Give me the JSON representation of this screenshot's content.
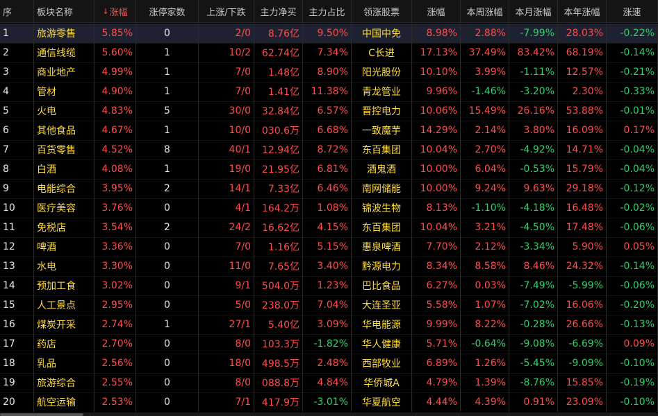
{
  "headers": [
    {
      "key": "idx",
      "label": "序"
    },
    {
      "key": "name",
      "label": "板块名称"
    },
    {
      "key": "pct",
      "label": "涨幅",
      "active": true
    },
    {
      "key": "limit",
      "label": "涨停家数"
    },
    {
      "key": "updown",
      "label": "上涨/下跌"
    },
    {
      "key": "netbuy",
      "label": "主力净买"
    },
    {
      "key": "ratio",
      "label": "主力占比"
    },
    {
      "key": "lead",
      "label": "领涨股票"
    },
    {
      "key": "lpct",
      "label": "涨幅"
    },
    {
      "key": "week",
      "label": "本周涨幅"
    },
    {
      "key": "month",
      "label": "本月涨幅"
    },
    {
      "key": "year",
      "label": "本年涨幅"
    },
    {
      "key": "speed",
      "label": "涨速"
    }
  ],
  "colors": {
    "red": "#ff4d4d",
    "green": "#2ed26a",
    "yellow": "#ffdc40",
    "white": "#e6e6e6"
  },
  "rows": [
    {
      "idx": "1",
      "name": "旅游零售",
      "pct": "5.85%",
      "limit": "0",
      "updown": "2/0",
      "netbuy": "8.76亿",
      "ratio": "9.50%",
      "lead": "中国中免",
      "lpct": "8.98%",
      "week": "2.88%",
      "month": "-7.99%",
      "year": "28.03%",
      "speed": "-0.22%"
    },
    {
      "idx": "2",
      "name": "通信线缆",
      "pct": "5.60%",
      "limit": "1",
      "updown": "10/2",
      "netbuy": "62.74亿",
      "ratio": "7.34%",
      "lead": "C长进",
      "lpct": "17.13%",
      "week": "37.49%",
      "month": "83.42%",
      "year": "68.19%",
      "speed": "-0.14%"
    },
    {
      "idx": "3",
      "name": "商业地产",
      "pct": "4.99%",
      "limit": "1",
      "updown": "7/0",
      "netbuy": "1.48亿",
      "ratio": "8.90%",
      "lead": "阳光股份",
      "lpct": "10.10%",
      "week": "3.99%",
      "month": "-1.11%",
      "year": "12.57%",
      "speed": "-0.21%"
    },
    {
      "idx": "4",
      "name": "管材",
      "pct": "4.90%",
      "limit": "1",
      "updown": "7/0",
      "netbuy": "1.41亿",
      "ratio": "11.38%",
      "lead": "青龙管业",
      "lpct": "9.96%",
      "week": "-1.46%",
      "month": "-3.20%",
      "year": "2.30%",
      "speed": "-0.33%"
    },
    {
      "idx": "5",
      "name": "火电",
      "pct": "4.83%",
      "limit": "5",
      "updown": "30/0",
      "netbuy": "32.84亿",
      "ratio": "6.57%",
      "lead": "晋控电力",
      "lpct": "10.06%",
      "week": "15.49%",
      "month": "26.16%",
      "year": "53.88%",
      "speed": "-0.01%"
    },
    {
      "idx": "6",
      "name": "其他食品",
      "pct": "4.67%",
      "limit": "1",
      "updown": "10/0",
      "netbuy": "030.6万",
      "ratio": "6.68%",
      "lead": "一致魔芋",
      "lpct": "14.29%",
      "week": "2.14%",
      "month": "3.80%",
      "year": "16.09%",
      "speed": "0.17%"
    },
    {
      "idx": "7",
      "name": "百货零售",
      "pct": "4.52%",
      "limit": "8",
      "updown": "40/1",
      "netbuy": "12.94亿",
      "ratio": "8.72%",
      "lead": "东百集团",
      "lpct": "10.04%",
      "week": "2.70%",
      "month": "-4.92%",
      "year": "14.71%",
      "speed": "-0.04%"
    },
    {
      "idx": "8",
      "name": "白酒",
      "pct": "4.08%",
      "limit": "1",
      "updown": "19/0",
      "netbuy": "21.95亿",
      "ratio": "6.81%",
      "lead": "酒鬼酒",
      "lpct": "10.00%",
      "week": "6.04%",
      "month": "-0.53%",
      "year": "15.79%",
      "speed": "-0.04%"
    },
    {
      "idx": "9",
      "name": "电能综合",
      "pct": "3.95%",
      "limit": "2",
      "updown": "14/1",
      "netbuy": "7.33亿",
      "ratio": "6.46%",
      "lead": "南网储能",
      "lpct": "10.00%",
      "week": "9.24%",
      "month": "9.63%",
      "year": "29.18%",
      "speed": "-0.12%"
    },
    {
      "idx": "10",
      "name": "医疗美容",
      "pct": "3.76%",
      "limit": "0",
      "updown": "4/1",
      "netbuy": "164.2万",
      "ratio": "1.08%",
      "lead": "锦波生物",
      "lpct": "8.13%",
      "week": "-1.10%",
      "month": "-4.18%",
      "year": "16.48%",
      "speed": "-0.02%"
    },
    {
      "idx": "11",
      "name": "免税店",
      "pct": "3.54%",
      "limit": "2",
      "updown": "24/2",
      "netbuy": "16.62亿",
      "ratio": "4.15%",
      "lead": "东百集团",
      "lpct": "10.04%",
      "week": "3.21%",
      "month": "-4.50%",
      "year": "17.48%",
      "speed": "-0.06%"
    },
    {
      "idx": "12",
      "name": "啤酒",
      "pct": "3.36%",
      "limit": "0",
      "updown": "7/0",
      "netbuy": "1.16亿",
      "ratio": "5.15%",
      "lead": "惠泉啤酒",
      "lpct": "7.70%",
      "week": "2.12%",
      "month": "-3.34%",
      "year": "5.90%",
      "speed": "0.05%"
    },
    {
      "idx": "13",
      "name": "水电",
      "pct": "3.30%",
      "limit": "0",
      "updown": "11/0",
      "netbuy": "7.65亿",
      "ratio": "3.40%",
      "lead": "黔源电力",
      "lpct": "8.34%",
      "week": "8.58%",
      "month": "8.46%",
      "year": "24.32%",
      "speed": "-0.14%"
    },
    {
      "idx": "14",
      "name": "预加工食",
      "pct": "3.02%",
      "limit": "0",
      "updown": "9/1",
      "netbuy": "504.0万",
      "ratio": "1.23%",
      "lead": "巴比食品",
      "lpct": "6.27%",
      "week": "0.03%",
      "month": "-7.49%",
      "year": "-5.99%",
      "speed": "-0.06%"
    },
    {
      "idx": "15",
      "name": "人工景点",
      "pct": "2.95%",
      "limit": "0",
      "updown": "5/0",
      "netbuy": "238.0万",
      "ratio": "7.04%",
      "lead": "大连圣亚",
      "lpct": "5.58%",
      "week": "1.07%",
      "month": "-7.02%",
      "year": "16.06%",
      "speed": "-0.20%"
    },
    {
      "idx": "16",
      "name": "煤炭开采",
      "pct": "2.74%",
      "limit": "1",
      "updown": "27/1",
      "netbuy": "5.40亿",
      "ratio": "3.09%",
      "lead": "华电能源",
      "lpct": "9.99%",
      "week": "8.22%",
      "month": "-0.28%",
      "year": "26.66%",
      "speed": "-0.13%"
    },
    {
      "idx": "17",
      "name": "药店",
      "pct": "2.70%",
      "limit": "0",
      "updown": "8/0",
      "netbuy": "103.3万",
      "ratio": "-1.82%",
      "lead": "华人健康",
      "lpct": "5.71%",
      "week": "-0.64%",
      "month": "-9.08%",
      "year": "-6.69%",
      "speed": "0.09%"
    },
    {
      "idx": "18",
      "name": "乳品",
      "pct": "2.56%",
      "limit": "0",
      "updown": "18/0",
      "netbuy": "498.5万",
      "ratio": "2.48%",
      "lead": "西部牧业",
      "lpct": "6.89%",
      "week": "1.26%",
      "month": "-5.45%",
      "year": "-9.09%",
      "speed": "-0.10%"
    },
    {
      "idx": "19",
      "name": "旅游综合",
      "pct": "2.55%",
      "limit": "0",
      "updown": "8/0",
      "netbuy": "088.8万",
      "ratio": "4.84%",
      "lead": "华侨城A",
      "lpct": "4.79%",
      "week": "1.39%",
      "month": "-8.76%",
      "year": "15.85%",
      "speed": "-0.19%"
    },
    {
      "idx": "20",
      "name": "航空运输",
      "pct": "2.53%",
      "limit": "0",
      "updown": "7/1",
      "netbuy": "417.9万",
      "ratio": "-3.01%",
      "lead": "华夏航空",
      "lpct": "4.44%",
      "week": "4.39%",
      "month": "0.91%",
      "year": "23.09%",
      "speed": "-0.10%"
    }
  ]
}
